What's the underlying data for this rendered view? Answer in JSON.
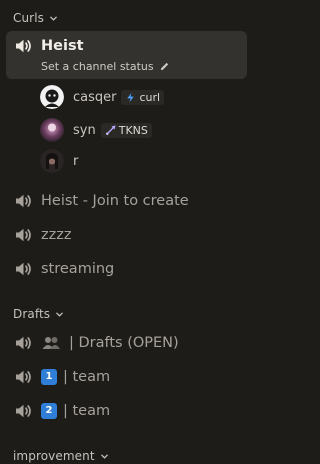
{
  "categories": {
    "curls": "Curls",
    "drafts": "Drafts",
    "improvement": "improvement"
  },
  "channels": {
    "heist": "Heist",
    "heist_status": "Set a channel status",
    "heist_join": "Heist - Join to create",
    "zzzz": "zzzz",
    "streaming": "streaming",
    "drafts_open": "| Drafts (OPEN)",
    "team1_emoji": "1",
    "team1": "| team",
    "team2_emoji": "2",
    "team2": "| team"
  },
  "members": [
    {
      "name": "casqer",
      "tag": "curl",
      "tag_icon": "lightning-icon"
    },
    {
      "name": "syn",
      "tag": "TKNS",
      "tag_icon": "swords-icon"
    },
    {
      "name": "r",
      "tag": "",
      "tag_icon": ""
    }
  ],
  "colors": {
    "background": "#1e1c18",
    "active_row": "#34322e",
    "text_muted": "#a6a29b",
    "text_bright": "#f2efe9",
    "emoji_blue": "#2f7fd8"
  }
}
